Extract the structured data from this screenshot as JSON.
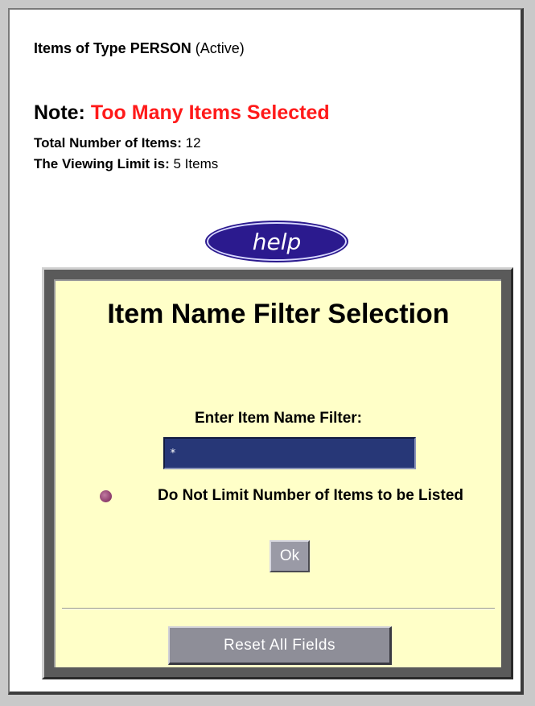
{
  "header": {
    "items_prefix": "Items of Type PERSON",
    "items_status": "(Active)"
  },
  "note": {
    "label": "Note:",
    "message": "Too Many Items Selected"
  },
  "stats": {
    "total_label": "Total Number of Items:",
    "total_value": "12",
    "limit_label": "The Viewing Limit is:",
    "limit_value": "5 Items"
  },
  "help_button": {
    "label": "help"
  },
  "panel": {
    "title": "Item Name Filter Selection",
    "filter_label": "Enter Item Name Filter:",
    "filter_value": "*",
    "radio_label": "Do Not Limit Number of Items to be Listed",
    "ok_label": "Ok",
    "reset_label": "Reset All Fields"
  },
  "colors": {
    "note_message": "#ff1a1a",
    "panel_background": "#ffffc8",
    "input_background": "#273777",
    "help_background": "#2b1a8e"
  },
  "icons": {
    "radio": "radio-selected-icon"
  }
}
